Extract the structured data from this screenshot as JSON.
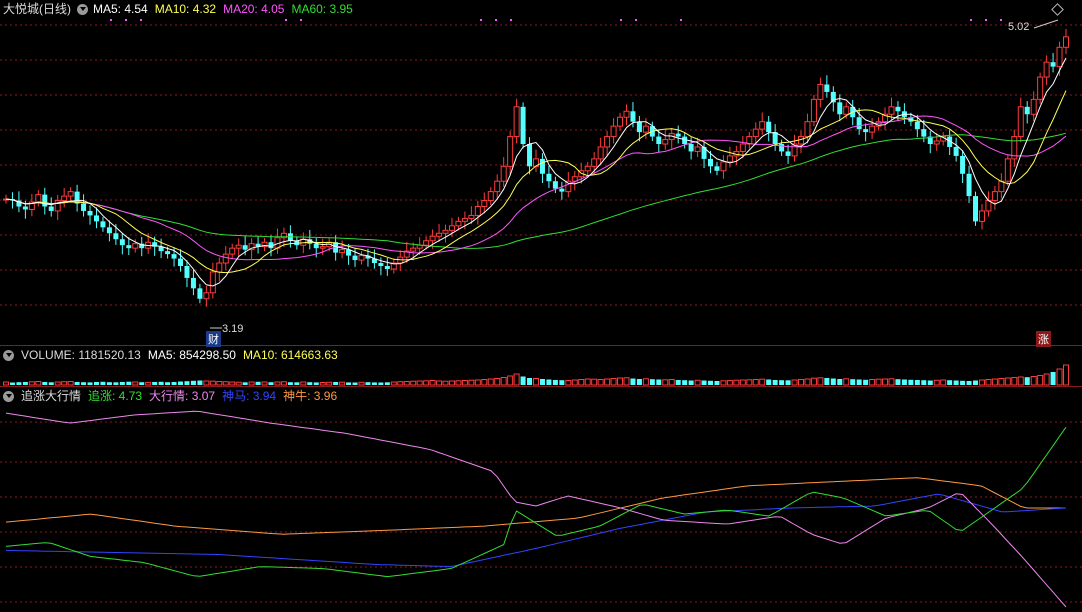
{
  "main": {
    "stock_name": "大悦城(日线)",
    "ma5": "MA5: 4.54",
    "ma10": "MA10: 4.32",
    "ma20": "MA20: 4.05",
    "ma60": "MA60: 3.95",
    "high_label": "5.02",
    "low_label": "3.19",
    "tag_cai": "财",
    "tag_zhang": "涨"
  },
  "volume": {
    "label": "VOLUME: 1181520.13",
    "ma5": "MA5: 854298.50",
    "ma10": "MA10: 614663.63"
  },
  "indicator": {
    "name": "追涨大行情",
    "zhuizhang": "追涨: 4.73",
    "daxingqing": "大行情: 3.07",
    "shenma": "神马: 3.94",
    "shenniu": "神牛: 3.96"
  },
  "colors": {
    "up": "#ff3c3c",
    "down": "#54ffff",
    "ma5": "#ffffff",
    "ma10": "#ffff55",
    "ma20": "#ff55ff",
    "ma60": "#33dd33",
    "grid": "#8a1a1a",
    "zhuizhang": "#33dd33",
    "daxingqing": "#ee88ee",
    "shenma": "#3344ff",
    "shenniu": "#ff9944"
  },
  "chart_data": {
    "type": "candlestick",
    "ylim": [
      3.05,
      5.12
    ],
    "closes": [
      3.93,
      3.92,
      3.88,
      3.86,
      3.91,
      3.96,
      3.88,
      3.85,
      3.92,
      3.95,
      3.98,
      3.9,
      3.85,
      3.82,
      3.78,
      3.74,
      3.7,
      3.66,
      3.62,
      3.6,
      3.63,
      3.6,
      3.64,
      3.61,
      3.58,
      3.56,
      3.53,
      3.48,
      3.4,
      3.33,
      3.26,
      3.3,
      3.44,
      3.5,
      3.56,
      3.6,
      3.62,
      3.59,
      3.63,
      3.61,
      3.64,
      3.6,
      3.67,
      3.7,
      3.65,
      3.62,
      3.66,
      3.63,
      3.6,
      3.61,
      3.64,
      3.57,
      3.59,
      3.55,
      3.52,
      3.55,
      3.53,
      3.5,
      3.48,
      3.46,
      3.5,
      3.54,
      3.58,
      3.6,
      3.62,
      3.65,
      3.68,
      3.7,
      3.72,
      3.75,
      3.78,
      3.8,
      3.82,
      3.88,
      3.92,
      3.98,
      4.05,
      4.15,
      4.35,
      4.55,
      4.3,
      4.15,
      4.2,
      4.1,
      4.05,
      4.0,
      3.98,
      4.05,
      4.08,
      4.12,
      4.15,
      4.2,
      4.28,
      4.35,
      4.42,
      4.48,
      4.52,
      4.45,
      4.38,
      4.42,
      4.35,
      4.3,
      4.33,
      4.37,
      4.35,
      4.3,
      4.25,
      4.28,
      4.2,
      4.15,
      4.12,
      4.18,
      4.22,
      4.25,
      4.3,
      4.35,
      4.4,
      4.45,
      4.38,
      4.3,
      4.25,
      4.22,
      4.3,
      4.35,
      4.45,
      4.6,
      4.7,
      4.65,
      4.58,
      4.5,
      4.55,
      4.48,
      4.4,
      4.38,
      4.42,
      4.45,
      4.5,
      4.55,
      4.52,
      4.48,
      4.45,
      4.4,
      4.35,
      4.3,
      4.32,
      4.35,
      4.28,
      4.22,
      4.1,
      3.95,
      3.78,
      3.85,
      3.92,
      3.98,
      4.05,
      4.2,
      4.35,
      4.55,
      4.5,
      4.6,
      4.75,
      4.85,
      4.82,
      4.95,
      5.02
    ],
    "volumes": [
      0.3,
      0.25,
      0.28,
      0.3,
      0.32,
      0.35,
      0.3,
      0.27,
      0.3,
      0.33,
      0.35,
      0.3,
      0.28,
      0.26,
      0.3,
      0.32,
      0.28,
      0.27,
      0.3,
      0.33,
      0.3,
      0.28,
      0.26,
      0.3,
      0.32,
      0.28,
      0.3,
      0.35,
      0.38,
      0.42,
      0.45,
      0.4,
      0.38,
      0.35,
      0.33,
      0.3,
      0.28,
      0.27,
      0.3,
      0.32,
      0.3,
      0.28,
      0.3,
      0.32,
      0.28,
      0.27,
      0.3,
      0.28,
      0.26,
      0.25,
      0.27,
      0.3,
      0.28,
      0.26,
      0.25,
      0.27,
      0.28,
      0.26,
      0.25,
      0.27,
      0.3,
      0.33,
      0.35,
      0.38,
      0.4,
      0.42,
      0.45,
      0.4,
      0.38,
      0.4,
      0.42,
      0.45,
      0.48,
      0.5,
      0.55,
      0.6,
      0.65,
      0.75,
      0.9,
      1.1,
      0.85,
      0.7,
      0.65,
      0.6,
      0.55,
      0.5,
      0.48,
      0.45,
      0.5,
      0.55,
      0.6,
      0.58,
      0.55,
      0.6,
      0.65,
      0.7,
      0.72,
      0.65,
      0.6,
      0.62,
      0.58,
      0.55,
      0.52,
      0.55,
      0.5,
      0.48,
      0.45,
      0.47,
      0.45,
      0.42,
      0.4,
      0.42,
      0.45,
      0.48,
      0.5,
      0.52,
      0.55,
      0.58,
      0.55,
      0.5,
      0.48,
      0.47,
      0.5,
      0.55,
      0.6,
      0.68,
      0.72,
      0.7,
      0.65,
      0.6,
      0.62,
      0.58,
      0.55,
      0.52,
      0.55,
      0.58,
      0.6,
      0.62,
      0.58,
      0.55,
      0.52,
      0.5,
      0.48,
      0.45,
      0.47,
      0.5,
      0.48,
      0.45,
      0.42,
      0.4,
      0.45,
      0.5,
      0.55,
      0.6,
      0.65,
      0.7,
      0.75,
      0.8,
      0.78,
      0.85,
      0.95,
      1.1,
      1.3,
      1.6,
      2.0
    ]
  }
}
